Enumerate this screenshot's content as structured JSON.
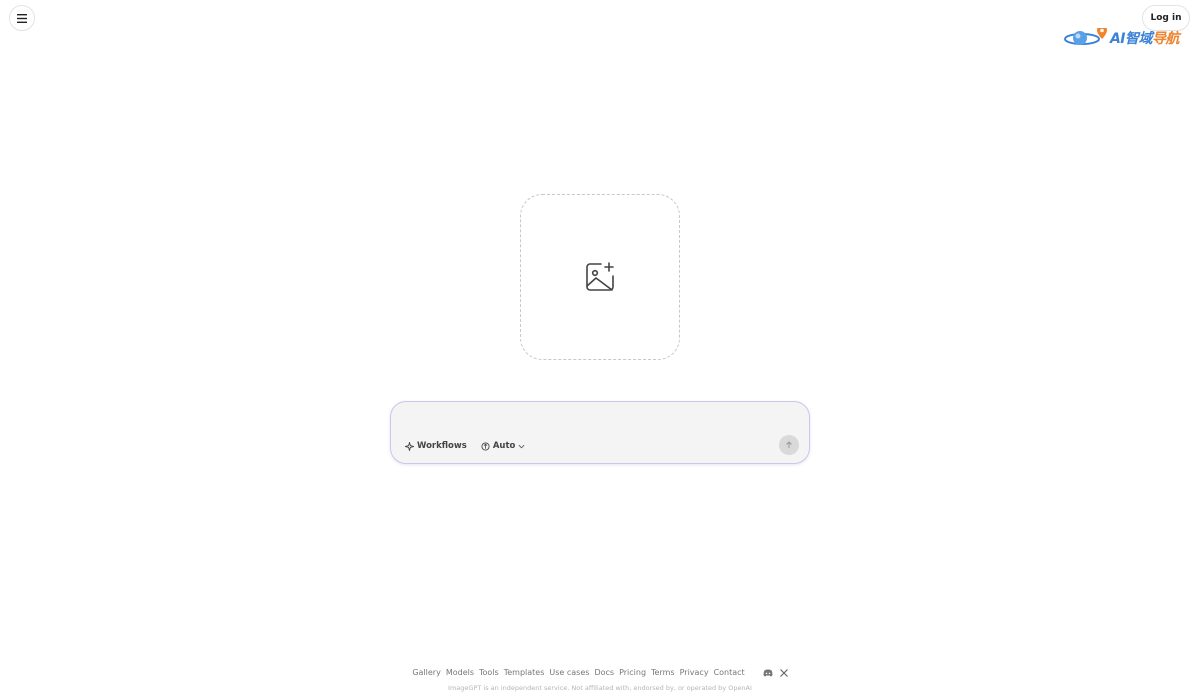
{
  "header": {
    "menu_icon": "hamburger-menu-icon",
    "login_label": "Log in",
    "watermark": {
      "brand": "AI",
      "text_main": "智域",
      "text_accent": "导航"
    }
  },
  "upload": {
    "icon": "image-plus-icon"
  },
  "prompt": {
    "placeholder": "",
    "value": "",
    "workflows_label": "Workflows",
    "model_label": "Auto",
    "send_icon": "arrow-up-icon"
  },
  "footer": {
    "links": [
      "Gallery",
      "Models",
      "Tools",
      "Templates",
      "Use cases",
      "Docs",
      "Pricing",
      "Terms",
      "Privacy",
      "Contact"
    ],
    "social": [
      "discord-icon",
      "x-icon"
    ],
    "disclaimer": "ImageGPT is an independent service. Not affiliated with, endorsed by, or operated by OpenAI"
  },
  "colors": {
    "accent_border": "#cfc6e8",
    "prompt_bg": "#f4f4f5",
    "dashed_border": "#c8c8c8"
  }
}
